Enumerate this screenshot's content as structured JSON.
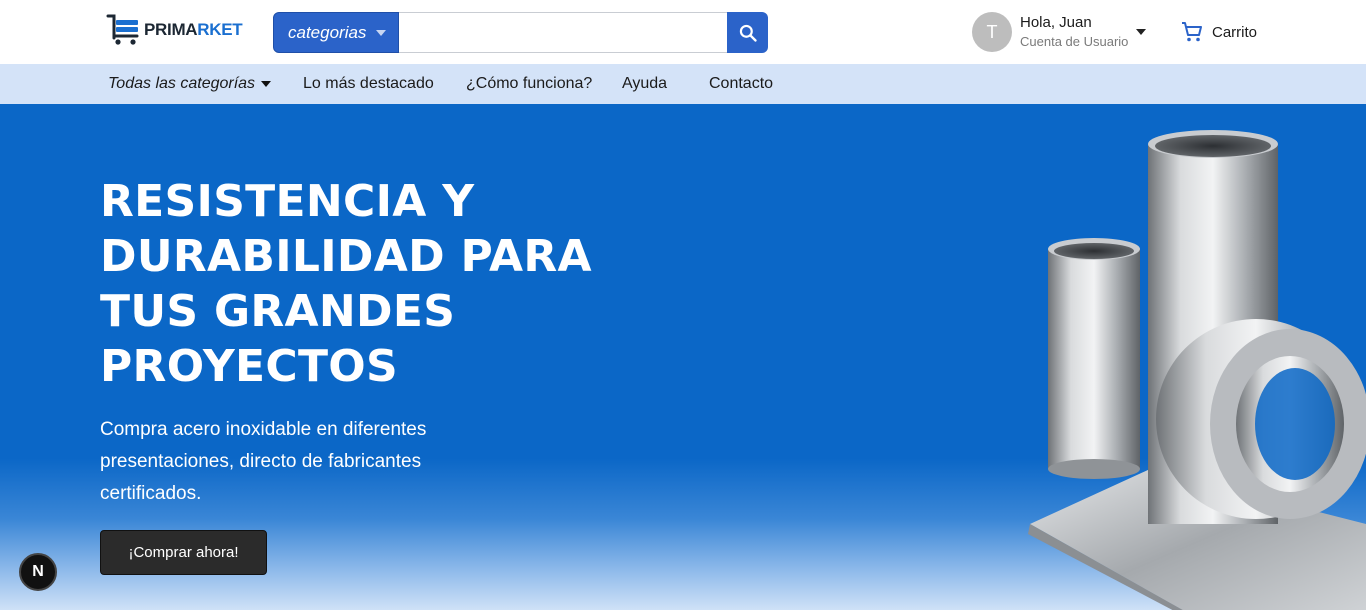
{
  "brand": {
    "name_part1": "PRIMA",
    "name_part2": "RKET",
    "accent": "#1a6fd0"
  },
  "search": {
    "category_label": "categorias",
    "placeholder": "",
    "button_icon": "search-icon"
  },
  "user": {
    "avatar_initial": "T",
    "greeting": "Hola, Juan",
    "subtitle": "Cuenta de Usuario"
  },
  "cart": {
    "label": "Carrito",
    "icon": "cart-icon"
  },
  "nav": {
    "all_categories": "Todas las categorías",
    "items": [
      "Lo más destacado",
      "¿Cómo funciona?",
      "Ayuda",
      "Contacto"
    ]
  },
  "hero": {
    "title": "RESISTENCIA Y DURABILIDAD PARA TUS GRANDES PROYECTOS",
    "subtitle": "Compra acero inoxidable en diferentes presentaciones, directo de fabricantes certificados.",
    "cta": "¡Comprar ahora!",
    "background": "#0b67c7"
  },
  "dev_badge": "N"
}
